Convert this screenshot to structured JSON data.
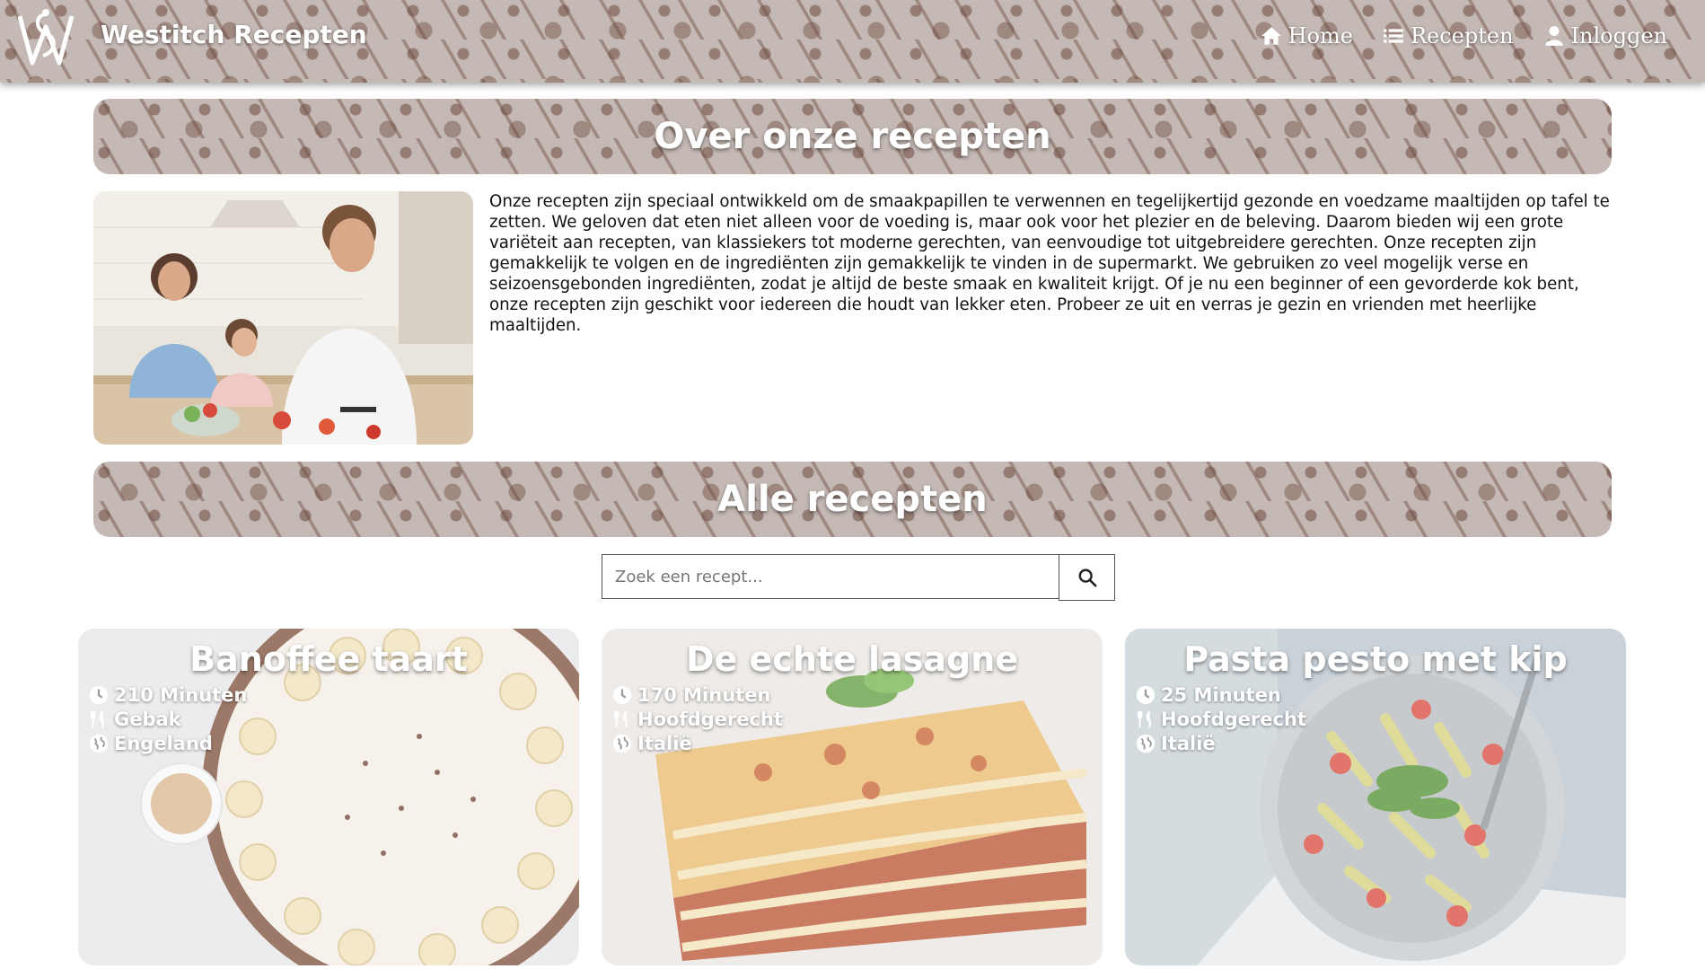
{
  "navbar": {
    "brand": "Westitch Recepten",
    "links": [
      {
        "label": "Home",
        "icon": "home-icon"
      },
      {
        "label": "Recepten",
        "icon": "list-icon"
      },
      {
        "label": "Inloggen",
        "icon": "user-icon"
      }
    ]
  },
  "about": {
    "title": "Over onze recepten",
    "text": "Onze recepten zijn speciaal ontwikkeld om de smaakpapillen te verwennen en tegelijkertijd gezonde en voedzame maaltijden op tafel te zetten. We geloven dat eten niet alleen voor de voeding is, maar ook voor het plezier en de beleving. Daarom bieden wij een grote variëteit aan recepten, van klassiekers tot moderne gerechten, van eenvoudige tot uitgebreidere gerechten. Onze recepten zijn gemakkelijk te volgen en de ingrediënten zijn gemakkelijk te vinden in de supermarkt. We gebruiken zo veel mogelijk verse en seizoensgebonden ingrediënten, zodat je altijd de beste smaak en kwaliteit krijgt. Of je nu een beginner of een gevorderde kok bent, onze recepten zijn geschikt voor iedereen die houdt van lekker eten. Probeer ze uit en verras je gezin en vrienden met heerlijke maaltijden."
  },
  "recipes_section": {
    "title": "Alle recepten",
    "search_placeholder": "Zoek een recept...",
    "search_value": ""
  },
  "recipes": [
    {
      "title": "Banoffee taart",
      "time": "210 Minuten",
      "category": "Gebak",
      "country": "Engeland"
    },
    {
      "title": "De echte lasagne",
      "time": "170 Minuten",
      "category": "Hoofdgerecht",
      "country": "Italië"
    },
    {
      "title": "Pasta pesto met kip",
      "time": "25 Minuten",
      "category": "Hoofdgerecht",
      "country": "Italië"
    }
  ],
  "colors": {
    "pattern_bg": "#c4b9b4",
    "pattern_ink": "#7a5246"
  }
}
